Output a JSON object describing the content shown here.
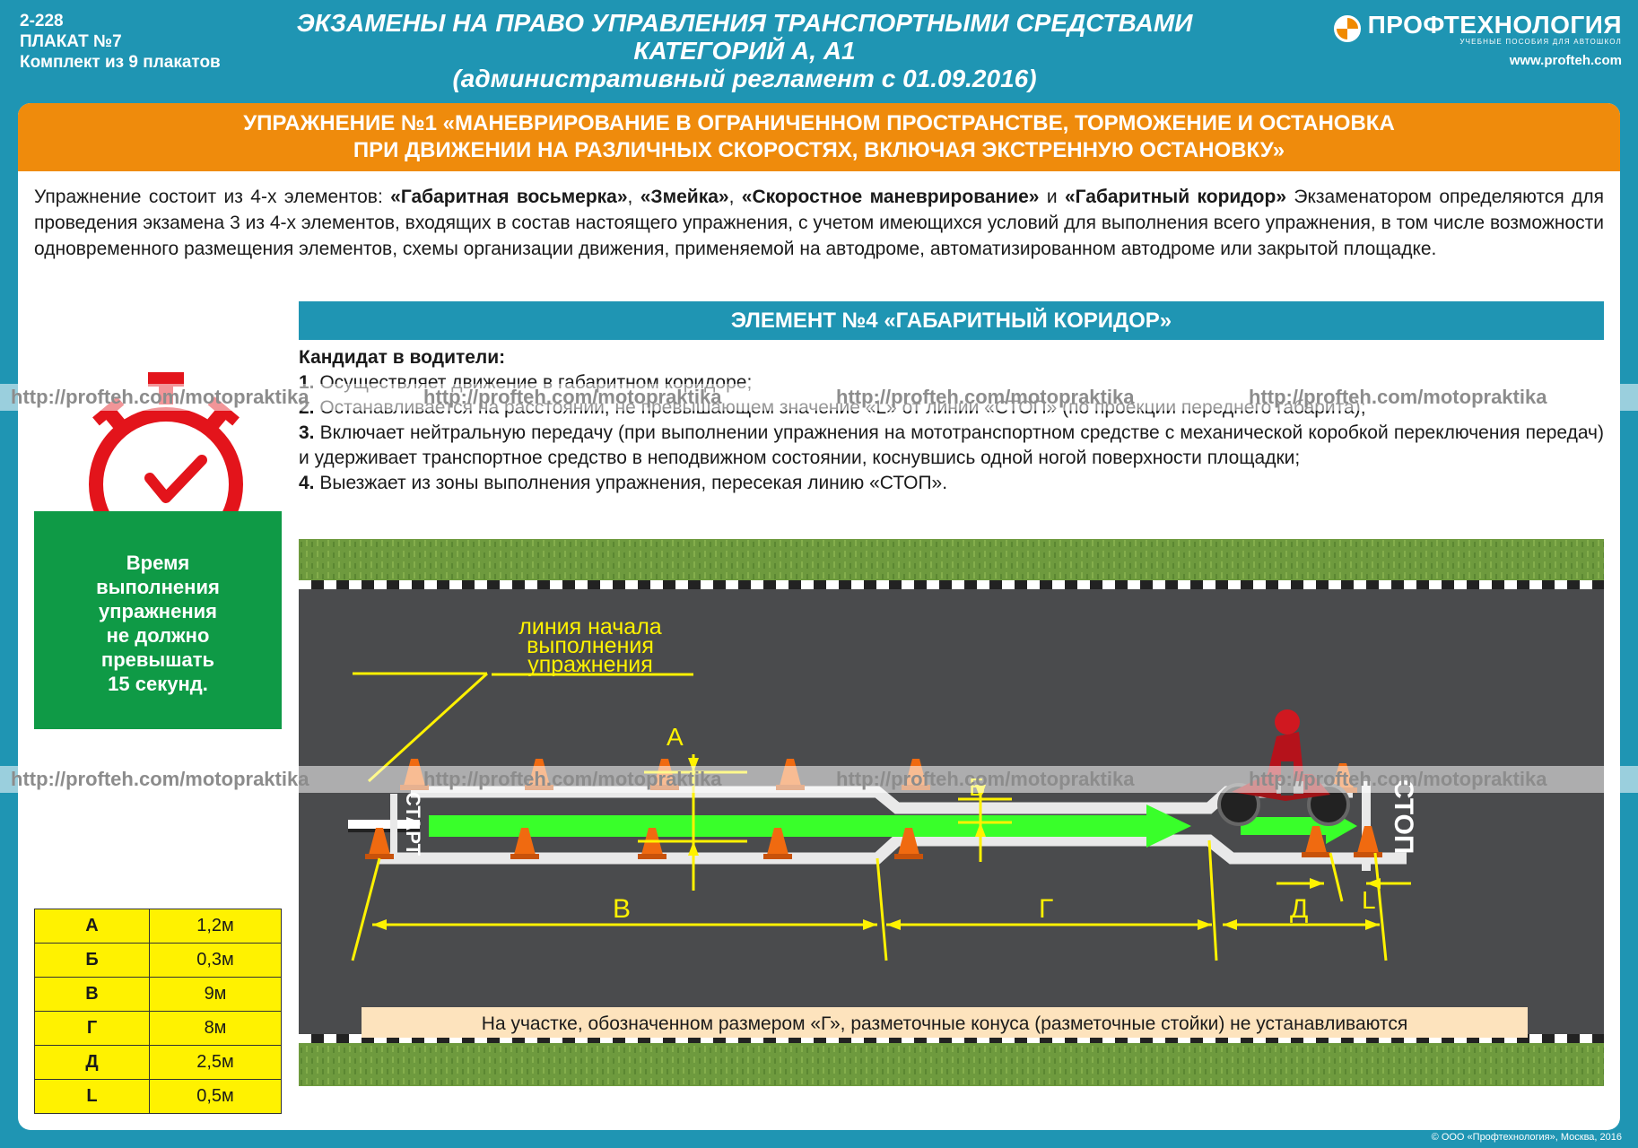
{
  "header": {
    "code": "2-228",
    "poster": "ПЛАКАТ №7",
    "set": "Комплект из 9 плакатов",
    "title_line1": "ЭКЗАМЕНЫ НА ПРАВО УПРАВЛЕНИЯ ТРАНСПОРТНЫМИ СРЕДСТВАМИ",
    "title_line2": "КАТЕГОРИЙ А, А1",
    "title_line3": "(административный регламент с 01.09.2016)",
    "logo_name": "ПРОФТЕХНОЛОГИЯ",
    "logo_sub": "УЧЕБНЫЕ ПОСОБИЯ ДЛЯ АВТОШКОЛ",
    "logo_url": "www.profteh.com"
  },
  "exercise_title_line1": "УПРАЖНЕНИЕ №1 «МАНЕВРИРОВАНИЕ В ОГРАНИЧЕННОМ ПРОСТРАНСТВЕ, ТОРМОЖЕНИЕ И ОСТАНОВКА",
  "exercise_title_line2": "ПРИ ДВИЖЕНИИ НА РАЗЛИЧНЫХ СКОРОСТЯХ, ВКЛЮЧАЯ ЭКСТРЕННУЮ ОСТАНОВКУ»",
  "intro": {
    "p1": "Упражнение состоит из 4-х элементов: ",
    "e1": "«Габаритная восьмерка»",
    "s1": ", ",
    "e2": "«Змейка»",
    "s2": ", ",
    "e3": "«Скоростное маневрирование»",
    "s3": " и ",
    "e4": "«Габаритный коридор»",
    "p2": " Экзаменатором определяются для проведения экзамена 3 из 4-х элементов, входящих в состав настоящего упражнения, с учетом имеющихся условий для выполнения всего упражнения, в том числе возможности одновременного размещения элементов, схемы организации движения, применяемой на автодроме, автоматизированном автодроме или закрытой площадке."
  },
  "element_title": "ЭЛЕМЕНТ №4 «ГАБАРИТНЫЙ КОРИДОР»",
  "candidate": {
    "head": "Кандидат в водители:",
    "items": [
      {
        "num": "1.",
        "text": " Осуществляет движение в габаритном коридоре;"
      },
      {
        "num": "2.",
        "text": " Останавливается на расстоянии, не превышающем значение «L» от линии «СТОП» (по проекции переднего габарита);"
      },
      {
        "num": "3.",
        "text": " Включает нейтральную передачу (при выполнении упражнения на мототранспортном средстве с механической коробкой переключения передач) и удерживает транспортное средство в неподвижном состоянии, коснувшись одной ногой поверхности площадки;"
      },
      {
        "num": "4.",
        "text": " Выезжает из зоны выполнения упражнения, пересекая линию «СТОП»."
      }
    ]
  },
  "time_box": {
    "l1": "Время",
    "l2": "выполнения",
    "l3": "упражнения",
    "l4": "не должно",
    "l5": "превышать",
    "l6": "15 секунд."
  },
  "dimensions": [
    {
      "key": "А",
      "value": "1,2м"
    },
    {
      "key": "Б",
      "value": "0,3м"
    },
    {
      "key": "В",
      "value": "9м"
    },
    {
      "key": "Г",
      "value": "8м"
    },
    {
      "key": "Д",
      "value": "2,5м"
    },
    {
      "key": "L",
      "value": "0,5м"
    }
  ],
  "scene": {
    "start_label": "СТАРТ",
    "stop_label": "СТОП",
    "start_line_l1": "линия начала",
    "start_line_l2": "выполнения",
    "start_line_l3": "упражнения",
    "dim_A": "А",
    "dim_B": "Б",
    "dim_V": "В",
    "dim_G": "Г",
    "dim_D": "Д",
    "dim_L": "L",
    "note": "На участке, обозначенном размером «Г», разметочные конуса (разметочные стойки) не устанавливаются"
  },
  "watermark": "http://profteh.com/motopraktika",
  "copyright": "© ООО «Профтехнология», Москва, 2016",
  "colors": {
    "background": "#1f95b3",
    "orange": "#ef8b0c",
    "green_box": "#0f9a46",
    "table_yellow": "#fff200",
    "timer_red": "#e3141b",
    "arrow_green": "#39ff2a",
    "asphalt": "#4a4b4d"
  }
}
